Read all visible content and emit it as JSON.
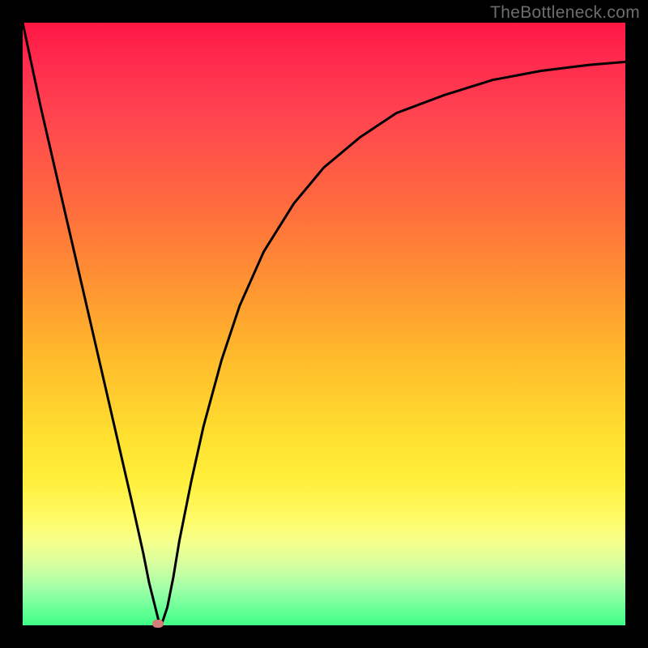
{
  "watermark": "TheBottleneck.com",
  "colors": {
    "frame": "#000000",
    "curve": "#000000",
    "marker": "#d67f7a"
  },
  "chart_data": {
    "type": "line",
    "title": "",
    "xlabel": "",
    "ylabel": "",
    "xlim": [
      0,
      100
    ],
    "ylim": [
      0,
      100
    ],
    "grid": false,
    "legend": false,
    "series": [
      {
        "name": "bottleneck-curve",
        "x": [
          0,
          3,
          6,
          9,
          12,
          15,
          18,
          20,
          21,
          22,
          22.5,
          23,
          24,
          25,
          26,
          28,
          30,
          33,
          36,
          40,
          45,
          50,
          56,
          62,
          70,
          78,
          86,
          94,
          100
        ],
        "values": [
          100,
          86,
          73,
          60,
          47,
          34,
          21,
          12,
          7,
          3,
          1,
          0,
          3,
          8,
          14,
          24,
          33,
          44,
          53,
          62,
          70,
          76,
          81,
          85,
          88,
          90.5,
          92,
          93,
          93.5
        ]
      }
    ],
    "minimum_point": {
      "x": 22.5,
      "y": 0
    },
    "gradient_stops": [
      {
        "pos": 0,
        "color": "#ff1744"
      },
      {
        "pos": 30,
        "color": "#ff6a3e"
      },
      {
        "pos": 55,
        "color": "#ffb92b"
      },
      {
        "pos": 82,
        "color": "#fffb64"
      },
      {
        "pos": 100,
        "color": "#3eff88"
      }
    ]
  }
}
